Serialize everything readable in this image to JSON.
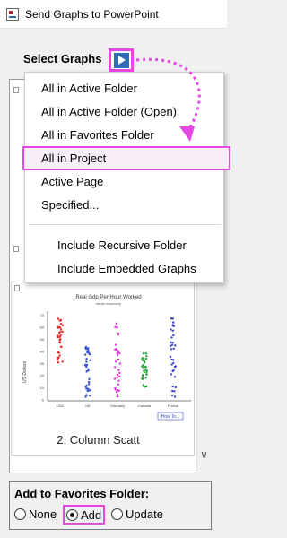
{
  "window": {
    "title": "Send Graphs to PowerPoint",
    "icon": "graph-window-icon"
  },
  "select": {
    "label": "Select Graphs",
    "button_icon": "play-arrow-icon"
  },
  "menu": {
    "items": [
      "All in Active Folder",
      "All in Active Folder (Open)",
      "All in Favorites Folder",
      "All in Project",
      "Active Page",
      "Specified..."
    ],
    "options": [
      "Include Recursive Folder",
      "Include Embedded Graphs"
    ],
    "highlighted": "All in Project"
  },
  "graph_list": {
    "caption": "2. Column Scatt",
    "thumbnail": {
      "title": "Real Gdp Per Hour Worked",
      "subtitle": "whole economy",
      "ylabel": "US Dollars",
      "yticks": [
        "70",
        "60",
        "50",
        "40",
        "30",
        "20",
        "10",
        "0"
      ],
      "categories": [
        "USA",
        "UK",
        "Germany",
        "Canada",
        "France"
      ],
      "colors": [
        "#e5302f",
        "#3350c9",
        "#d93ad4",
        "#2aa33a",
        "#3a44c2"
      ],
      "howto": "How To..."
    }
  },
  "favorites": {
    "label": "Add to Favorites Folder:",
    "options": [
      "None",
      "Add",
      "Update"
    ],
    "selected": "Add"
  },
  "colors": {
    "highlight": "#e648e6",
    "button": "#2f6fb7"
  }
}
